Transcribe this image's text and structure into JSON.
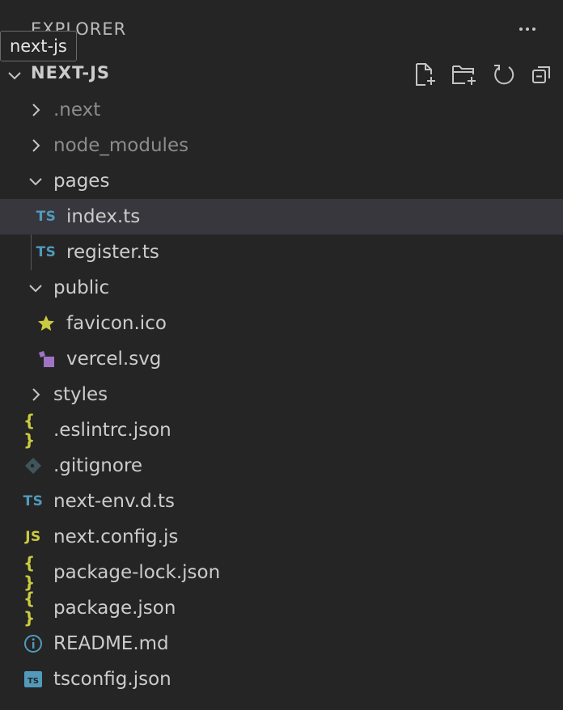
{
  "header": {
    "title": "EXPLORER",
    "tooltip": "next-js"
  },
  "section": {
    "title": "NEXT-JS",
    "actions": [
      {
        "name": "new-file-icon"
      },
      {
        "name": "new-folder-icon"
      },
      {
        "name": "refresh-icon"
      },
      {
        "name": "collapse-all-icon"
      }
    ]
  },
  "colors": {
    "background": "#252526",
    "selected_row": "#37373d",
    "ts_icon": "#519aba",
    "json_icon": "#cbcb41",
    "svg_icon": "#a074c4",
    "git_icon": "#41535b"
  },
  "tree": [
    {
      "label": ".next",
      "type": "folder",
      "expanded": false,
      "depth": 1,
      "dim": true
    },
    {
      "label": "node_modules",
      "type": "folder",
      "expanded": false,
      "depth": 1,
      "dim": true
    },
    {
      "label": "pages",
      "type": "folder",
      "expanded": true,
      "depth": 1
    },
    {
      "label": "index.ts",
      "type": "file",
      "icon": "ts-icon",
      "icon_text": "TS",
      "depth": 2,
      "selected": true
    },
    {
      "label": "register.ts",
      "type": "file",
      "icon": "ts-icon",
      "icon_text": "TS",
      "depth": 2
    },
    {
      "label": "public",
      "type": "folder",
      "expanded": true,
      "depth": 1
    },
    {
      "label": "favicon.ico",
      "type": "file",
      "icon": "star-icon",
      "depth": 2
    },
    {
      "label": "vercel.svg",
      "type": "file",
      "icon": "svg-icon",
      "depth": 2
    },
    {
      "label": "styles",
      "type": "folder",
      "expanded": false,
      "depth": 1
    },
    {
      "label": ".eslintrc.json",
      "type": "file",
      "icon": "json-icon",
      "icon_text": "{ }",
      "depth": 1
    },
    {
      "label": ".gitignore",
      "type": "file",
      "icon": "git-icon",
      "depth": 1
    },
    {
      "label": "next-env.d.ts",
      "type": "file",
      "icon": "ts-icon",
      "icon_text": "TS",
      "depth": 1
    },
    {
      "label": "next.config.js",
      "type": "file",
      "icon": "js-icon",
      "icon_text": "JS",
      "depth": 1
    },
    {
      "label": "package-lock.json",
      "type": "file",
      "icon": "json-icon",
      "icon_text": "{ }",
      "depth": 1
    },
    {
      "label": "package.json",
      "type": "file",
      "icon": "json-icon",
      "icon_text": "{ }",
      "depth": 1
    },
    {
      "label": "README.md",
      "type": "file",
      "icon": "info-icon",
      "depth": 1
    },
    {
      "label": "tsconfig.json",
      "type": "file",
      "icon": "tsconfig-icon",
      "icon_text": "TS",
      "depth": 1
    }
  ]
}
